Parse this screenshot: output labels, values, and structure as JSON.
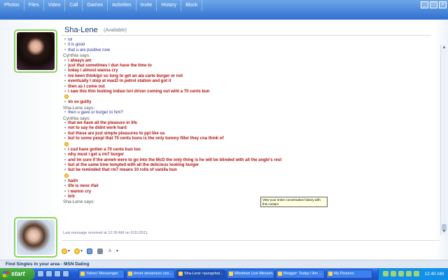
{
  "menubar": {
    "items": [
      "Photos",
      "Files",
      "Video",
      "Call",
      "Games",
      "Activities",
      "Invite",
      "History",
      "Block"
    ]
  },
  "contact": {
    "name": "Sha-Lene",
    "status": "(Available)"
  },
  "conversation": [
    {
      "kind": "msg",
      "who": "me",
      "text": "lol"
    },
    {
      "kind": "msg",
      "who": "me",
      "text": "it is good"
    },
    {
      "kind": "msg",
      "who": "me",
      "text": "that u are positive now"
    },
    {
      "kind": "says",
      "text": "Cynthia says:"
    },
    {
      "kind": "msg",
      "who": "them",
      "text": "i always am"
    },
    {
      "kind": "msg",
      "who": "them",
      "text": "just that sometimes I dun have the time to"
    },
    {
      "kind": "msg",
      "who": "them",
      "text": "today i almost wanna cry"
    },
    {
      "kind": "msg",
      "who": "them",
      "text": "ive been thinkign so long to get an ala carte burger or not"
    },
    {
      "kind": "msg",
      "who": "them",
      "text": "eventually I stop at macD in petrol station and got it"
    },
    {
      "kind": "msg",
      "who": "them",
      "text": "then as I come out"
    },
    {
      "kind": "msg",
      "who": "them",
      "text": "i saw this thin looking indian lori driver coming out wiht a 70 cents bun"
    },
    {
      "kind": "emoticon"
    },
    {
      "kind": "msg",
      "who": "them",
      "text": "im so guilty"
    },
    {
      "kind": "says",
      "text": "Sha-Lene says:"
    },
    {
      "kind": "msg",
      "who": "me",
      "text": "then u gave ur burger to him?"
    },
    {
      "kind": "says",
      "text": "Cynthia says:"
    },
    {
      "kind": "msg",
      "who": "them",
      "text": "that we have all the pleasure in life"
    },
    {
      "kind": "msg",
      "who": "them",
      "text": "not to say he didnt work hard"
    },
    {
      "kind": "msg",
      "who": "them",
      "text": "but these are just simple pleasures to ppl like us"
    },
    {
      "kind": "msg",
      "who": "them",
      "text": "but to some peopl that 70 cents buns is the only tummy filler they cna think of"
    },
    {
      "kind": "emoticon"
    },
    {
      "kind": "msg",
      "who": "them",
      "text": "i cud have gotten a 70 cents bun too"
    },
    {
      "kind": "msg",
      "who": "them",
      "text": "why must i get a rm7 burger"
    },
    {
      "kind": "msg",
      "who": "them",
      "text": "and im sure if the anneh were to go into the McD the only thing is he will be blinded with all the angle's rest"
    },
    {
      "kind": "msg",
      "who": "them",
      "text": "but at the same time tempted with all the delicious looking burger"
    },
    {
      "kind": "msg",
      "who": "them",
      "text": "but be reminded that rm7 means 10 rolls of vanilla bun"
    },
    {
      "kind": "emoticon"
    },
    {
      "kind": "msg",
      "who": "them",
      "text": "haiih"
    },
    {
      "kind": "msg",
      "who": "them",
      "text": "life is neve rfair"
    },
    {
      "kind": "msg",
      "who": "them",
      "text": "i wannn cry"
    },
    {
      "kind": "msg",
      "who": "them",
      "text": "brb"
    },
    {
      "kind": "says",
      "text": "Sha-Lene says:"
    }
  ],
  "tooltip": "View your entire conversation history with this contact",
  "last_message": "Last message received at 12:39 AM on 5/31/2011.",
  "toolbar": {
    "items": [
      {
        "icon": "smile-icon",
        "label": "▾"
      },
      {
        "icon": "wink-icon",
        "label": "▾"
      },
      {
        "icon": "nudge-icon",
        "label": ""
      },
      {
        "icon": "voice-clip-icon",
        "label": ""
      },
      {
        "icon": "font-icon",
        "label": "A"
      },
      {
        "icon": "font-color-icon",
        "label": "▾"
      }
    ]
  },
  "ad_text": "Find Singles in your area - MSN Dating",
  "taskbar": {
    "start_label": "start",
    "tasks": [
      {
        "label": "Yahoo! Messenger",
        "active": false
      },
      {
        "label": "tinnet streamxxx con...",
        "active": false
      },
      {
        "label": "Sha-Lene <pungshal...",
        "active": true
      },
      {
        "label": "Windows Live Messen...",
        "active": false
      },
      {
        "label": "Blogger: Today I Am ...",
        "active": false
      },
      {
        "label": "My Pictures",
        "active": false
      }
    ],
    "clock": "12:40 AM"
  },
  "colors": {
    "menu_bar": "#2f6fcf",
    "my_text": "#2a2f9a",
    "their_text": "#b21111",
    "taskbar": "#245dd7",
    "start_button": "#33922f"
  }
}
